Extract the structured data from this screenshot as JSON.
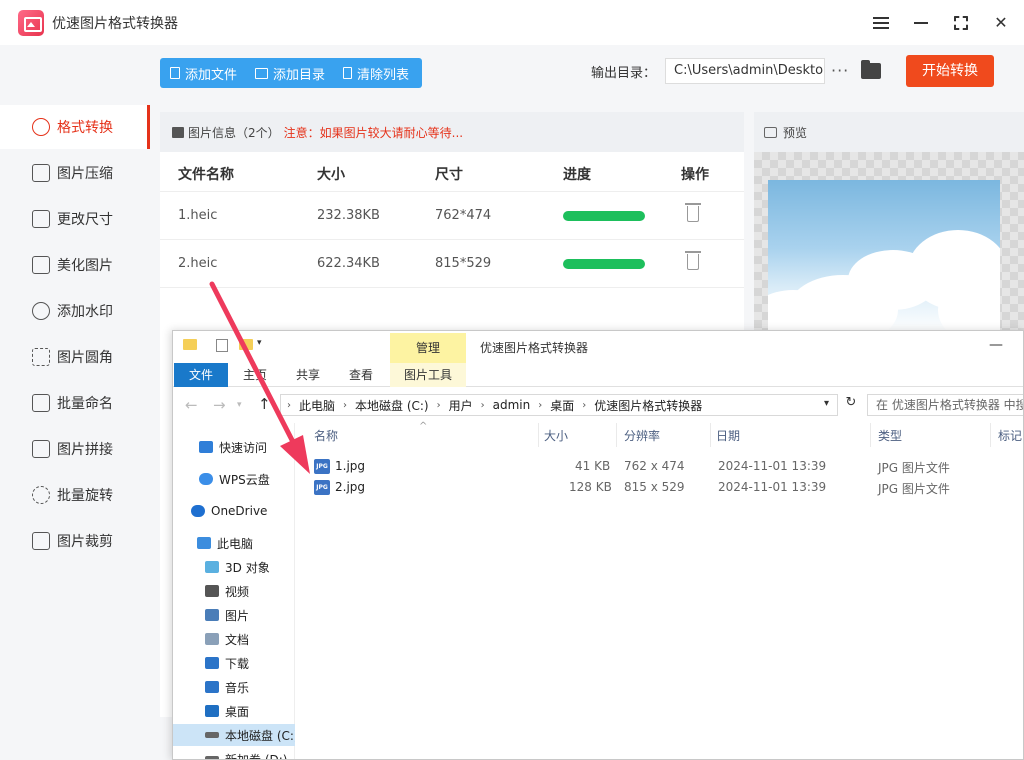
{
  "app": {
    "title": "优速图片格式转换器"
  },
  "sidebar": {
    "items": [
      {
        "label": "格式转换",
        "icon": "format-convert-icon",
        "active": true
      },
      {
        "label": "图片压缩",
        "icon": "compress-icon"
      },
      {
        "label": "更改尺寸",
        "icon": "resize-icon"
      },
      {
        "label": "美化图片",
        "icon": "beautify-icon"
      },
      {
        "label": "添加水印",
        "icon": "watermark-icon"
      },
      {
        "label": "图片圆角",
        "icon": "round-corner-icon"
      },
      {
        "label": "批量命名",
        "icon": "rename-icon"
      },
      {
        "label": "图片拼接",
        "icon": "stitch-icon"
      },
      {
        "label": "批量旋转",
        "icon": "rotate-icon"
      },
      {
        "label": "图片裁剪",
        "icon": "crop-icon"
      }
    ]
  },
  "toolbar": {
    "add_file": "添加文件",
    "add_dir": "添加目录",
    "clear_list": "清除列表",
    "output_label": "输出目录：",
    "output_path": "C:\\Users\\admin\\Deskto",
    "more": "···",
    "start": "开始转换"
  },
  "info": {
    "title": "图片信息（2个）",
    "warning": "注意：如果图片较大请耐心等待..."
  },
  "table": {
    "headers": {
      "name": "文件名称",
      "size": "大小",
      "dims": "尺寸",
      "progress": "进度",
      "actions": "操作"
    },
    "rows": [
      {
        "name": "1.heic",
        "size": "232.38KB",
        "dims": "762*474",
        "progress": 1.0
      },
      {
        "name": "2.heic",
        "size": "622.34KB",
        "dims": "815*529",
        "progress": 1.0
      }
    ]
  },
  "preview": {
    "title": "预览"
  },
  "explorer": {
    "manage": "管理",
    "window_title": "优速图片格式转换器",
    "minimize": "—",
    "tabs": {
      "file": "文件",
      "home": "主页",
      "share": "共享",
      "view": "查看",
      "pic_tools": "图片工具"
    },
    "breadcrumb": [
      "此电脑",
      "本地磁盘 (C:)",
      "用户",
      "admin",
      "桌面",
      "优速图片格式转换器"
    ],
    "search_placeholder": "在 优速图片格式转换器 中搜",
    "nav": [
      {
        "label": "快速访问",
        "color": "#2f7ed8"
      },
      {
        "label": "WPS云盘",
        "color": "#3b8ee8"
      },
      {
        "label": "OneDrive",
        "color": "#1e6fd0"
      },
      {
        "label": "此电脑",
        "color": "#3c8dde"
      },
      {
        "label": "3D 对象",
        "color": "#5ab0e0"
      },
      {
        "label": "视频",
        "color": "#555555"
      },
      {
        "label": "图片",
        "color": "#4a7db8"
      },
      {
        "label": "文档",
        "color": "#8aa0b8"
      },
      {
        "label": "下载",
        "color": "#2b74c8"
      },
      {
        "label": "音乐",
        "color": "#2b74c8"
      },
      {
        "label": "桌面",
        "color": "#1f6fc2"
      },
      {
        "label": "本地磁盘 (C:)",
        "color": "#666666"
      },
      {
        "label": "新加卷 (D:)",
        "color": "#666666"
      }
    ],
    "columns": {
      "name": "名称",
      "size": "大小",
      "resolution": "分辨率",
      "date": "日期",
      "type": "类型",
      "tags": "标记"
    },
    "files": [
      {
        "name": "1.jpg",
        "size": "41 KB",
        "resolution": "762 x 474",
        "date": "2024-11-01 13:39",
        "type": "JPG 图片文件"
      },
      {
        "name": "2.jpg",
        "size": "128 KB",
        "resolution": "815 x 529",
        "date": "2024-11-01 13:39",
        "type": "JPG 图片文件"
      }
    ]
  },
  "colors": {
    "accent": "#e5321a",
    "toolbar_blue": "#39a2ef",
    "start_orange": "#f04a1d",
    "progress_green": "#1dbf5c",
    "arrow_pink": "#ee3a5c"
  }
}
